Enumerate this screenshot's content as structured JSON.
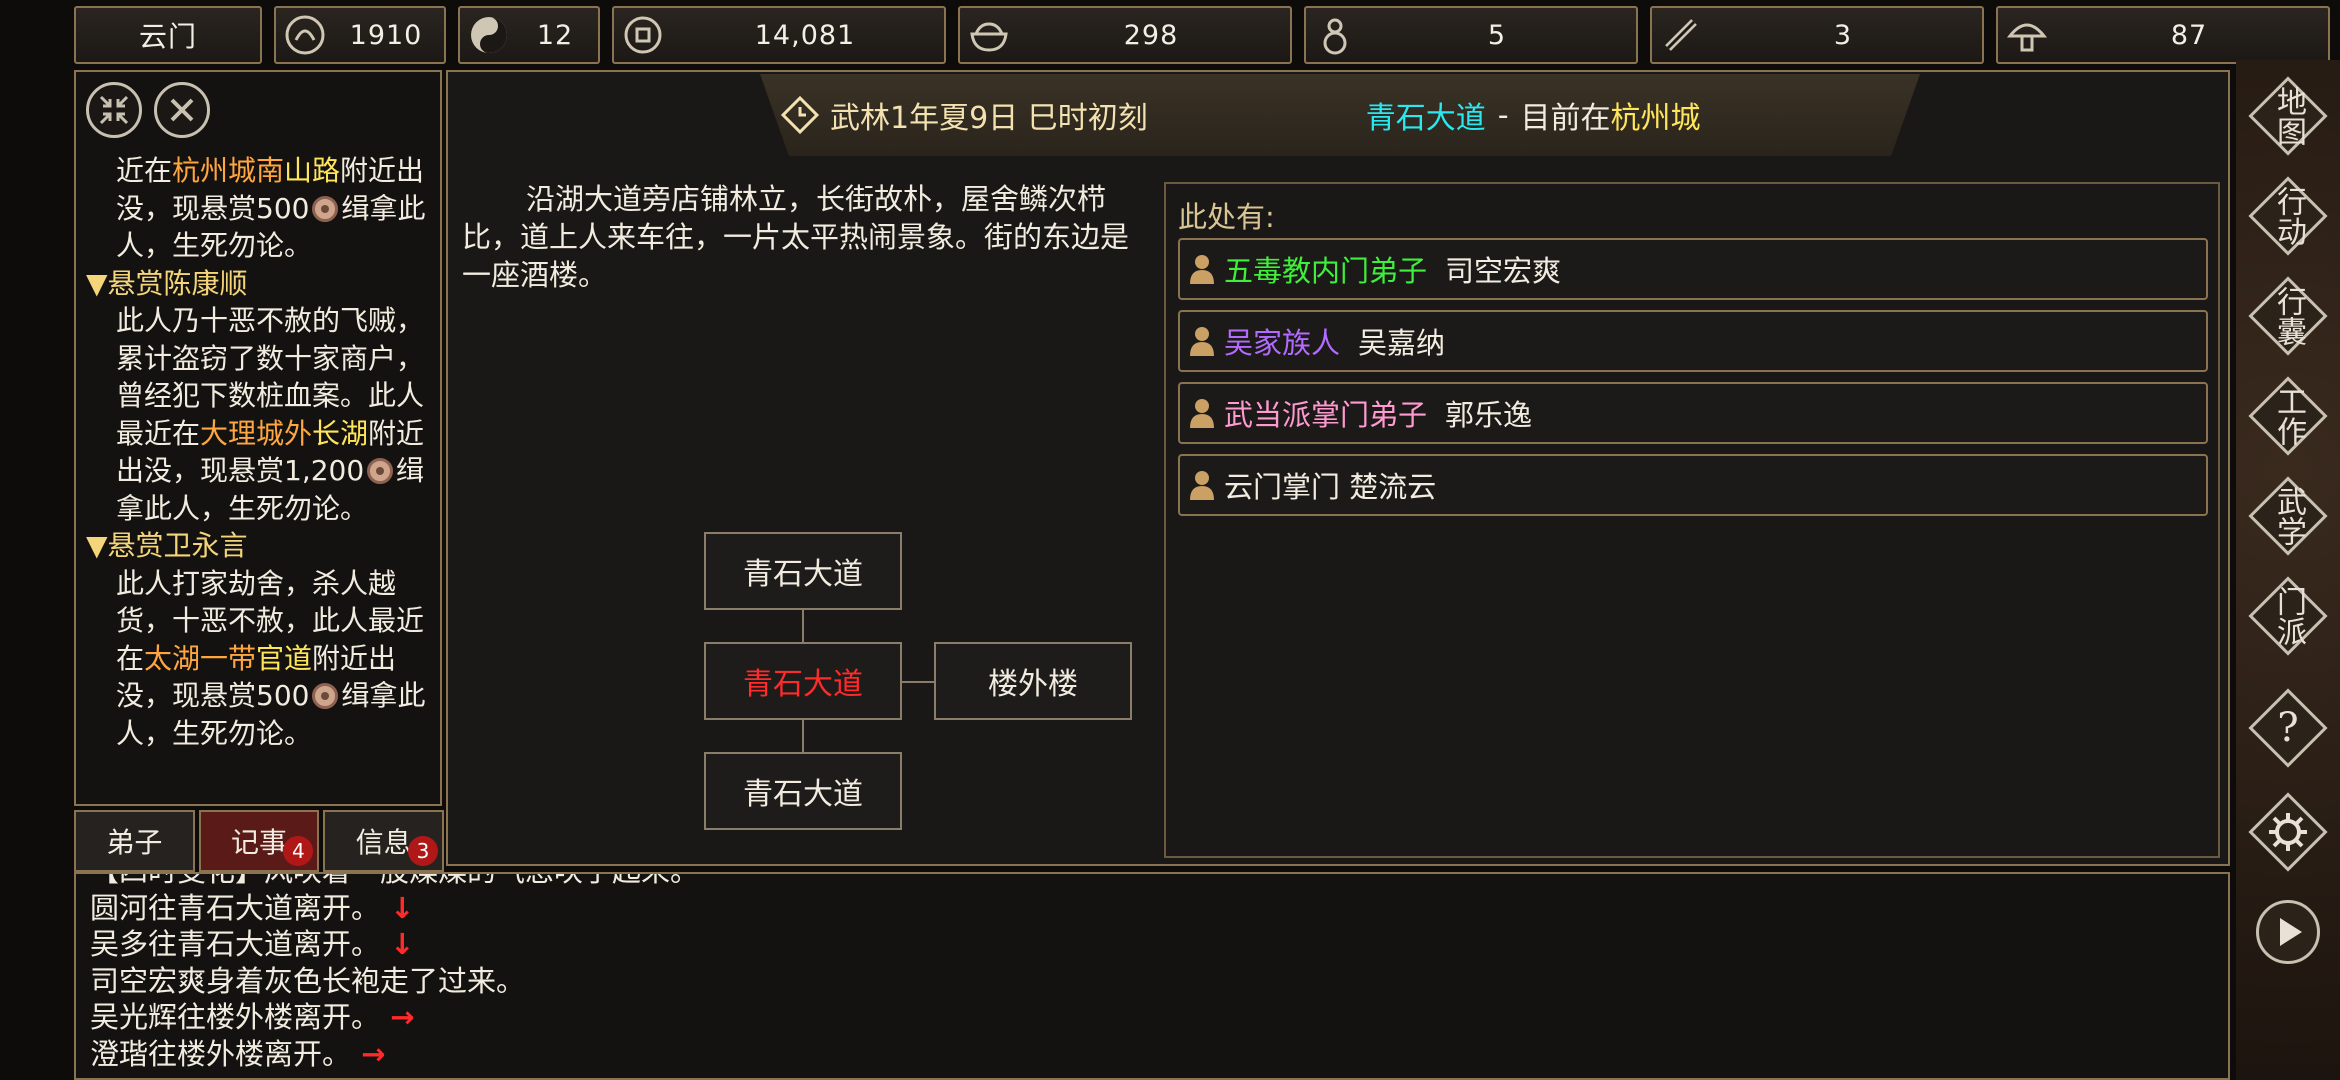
{
  "topbar": {
    "sect": "云门",
    "stats": [
      {
        "icon": "reputation-icon",
        "value": "1910"
      },
      {
        "icon": "yin-yang-icon",
        "value": "12"
      },
      {
        "icon": "copper-coin-icon",
        "value": "14,081"
      },
      {
        "icon": "food-bowl-icon",
        "value": "298"
      },
      {
        "icon": "gourd-icon",
        "value": "5"
      },
      {
        "icon": "scroll-icon",
        "value": "3"
      },
      {
        "icon": "mushroom-icon",
        "value": "87"
      }
    ]
  },
  "left": {
    "quests": [
      {
        "title": "",
        "body": [
          {
            "t": "近在"
          },
          {
            "t": "杭州城南",
            "c": "o"
          },
          {
            "t": "山路",
            "c": "y"
          },
          {
            "t": "附近出没，现悬赏500"
          },
          {
            "coin": true
          },
          {
            "t": "缉拿此人，生死勿论。"
          }
        ]
      },
      {
        "title": "▼悬赏陈康顺",
        "body": [
          {
            "t": "此人乃十恶不赦的飞贼，累计盗窃了数十家商户，曾经犯下数桩血案。此人最近在"
          },
          {
            "t": "大理城外",
            "c": "o"
          },
          {
            "t": "长湖",
            "c": "y"
          },
          {
            "t": "附近出没，现悬赏1,200"
          },
          {
            "coin": true
          },
          {
            "t": "缉拿此人，生死勿论。"
          }
        ]
      },
      {
        "title": "▼悬赏卫永言",
        "body": [
          {
            "t": "此人打家劫舍，杀人越货，十恶不赦，此人最近在"
          },
          {
            "t": "太湖一带",
            "c": "o"
          },
          {
            "t": "官道",
            "c": "y"
          },
          {
            "t": "附近出没，现悬赏500"
          },
          {
            "coin": true
          },
          {
            "t": "缉拿此人，生死勿论。"
          }
        ]
      }
    ],
    "tabs": [
      {
        "label": "弟子",
        "badge": ""
      },
      {
        "label": "记事",
        "badge": "4"
      },
      {
        "label": "信息",
        "badge": "3"
      }
    ]
  },
  "header": {
    "date": "武林1年夏9日 巳时初刻",
    "place": "青石大道",
    "dash": "-",
    "current_prefix": "目前在",
    "city": "杭州城"
  },
  "description": "沿湖大道旁店铺林立，长街故朴，屋舍鳞次栉比，道上人来车往，一片太平热闹景象。街的东边是一座酒楼。",
  "map": {
    "north": "青石大道",
    "center": "青石大道",
    "east": "楼外楼",
    "south": "青石大道"
  },
  "here": {
    "title": "此处有:",
    "npcs": [
      {
        "faction": "五毒教内门弟子",
        "color": "#3ff03a",
        "name": "司空宏爽"
      },
      {
        "faction": "吴家族人",
        "color": "#b36bff",
        "name": "吴嘉纳"
      },
      {
        "faction": "武当派掌门弟子",
        "color": "#ff9ad0",
        "name": "郭乐逸"
      },
      {
        "faction": "",
        "color": "#f2ece0",
        "name": "云门掌门 楚流云"
      }
    ]
  },
  "menu": [
    "地图",
    "行动",
    "行囊",
    "工作",
    "武学",
    "门派",
    "?",
    "settings",
    "play"
  ],
  "log": [
    {
      "text": "【四时变化】风吹着一股燥燥的气息吹了起来。",
      "arrow": ""
    },
    {
      "text": "圆河往青石大道离开。",
      "arrow": "↓"
    },
    {
      "text": "吴多往青石大道离开。",
      "arrow": "↓"
    },
    {
      "text": "司空宏爽身着灰色长袍走了过来。",
      "arrow": ""
    },
    {
      "text": "吴光辉往楼外楼离开。",
      "arrow": "→"
    },
    {
      "text": "澄瑎往楼外楼离开。",
      "arrow": "→"
    }
  ],
  "colors": {
    "border": "#8a7350",
    "highlight_orange": "#ffa640",
    "highlight_yellow": "#ffe55a",
    "place_cyan": "#29e8ef",
    "current_room_red": "#ff2b2b"
  }
}
